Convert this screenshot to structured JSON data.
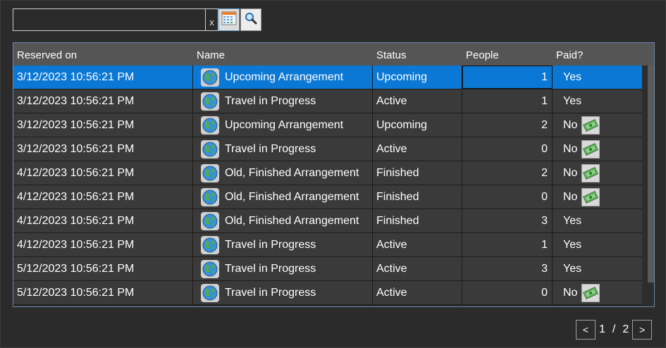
{
  "toolbar": {
    "search_value": "",
    "clear_label": "x",
    "calendar_icon": "calendar-icon",
    "search_icon": "magnifier-icon"
  },
  "grid": {
    "columns": [
      "Reserved on",
      "Name",
      "Status",
      "People",
      "Paid?"
    ],
    "rows": [
      {
        "reserved_on": "3/12/2023 10:56:21 PM",
        "name": "Upcoming Arrangement",
        "status": "Upcoming",
        "people": "1",
        "paid": "Yes",
        "paid_icon": false,
        "selected": true
      },
      {
        "reserved_on": "3/12/2023 10:56:21 PM",
        "name": "Travel in Progress",
        "status": "Active",
        "people": "1",
        "paid": "Yes",
        "paid_icon": false
      },
      {
        "reserved_on": "3/12/2023 10:56:21 PM",
        "name": "Upcoming Arrangement",
        "status": "Upcoming",
        "people": "2",
        "paid": "No",
        "paid_icon": true
      },
      {
        "reserved_on": "3/12/2023 10:56:21 PM",
        "name": "Travel in Progress",
        "status": "Active",
        "people": "0",
        "paid": "No",
        "paid_icon": true
      },
      {
        "reserved_on": "4/12/2023 10:56:21 PM",
        "name": "Old, Finished Arrangement",
        "status": "Finished",
        "people": "2",
        "paid": "No",
        "paid_icon": true
      },
      {
        "reserved_on": "4/12/2023 10:56:21 PM",
        "name": "Old, Finished Arrangement",
        "status": "Finished",
        "people": "0",
        "paid": "No",
        "paid_icon": true
      },
      {
        "reserved_on": "4/12/2023 10:56:21 PM",
        "name": "Old, Finished Arrangement",
        "status": "Finished",
        "people": "3",
        "paid": "Yes",
        "paid_icon": false
      },
      {
        "reserved_on": "4/12/2023 10:56:21 PM",
        "name": "Travel in Progress",
        "status": "Active",
        "people": "1",
        "paid": "Yes",
        "paid_icon": false
      },
      {
        "reserved_on": "5/12/2023 10:56:21 PM",
        "name": "Travel in Progress",
        "status": "Active",
        "people": "3",
        "paid": "Yes",
        "paid_icon": false
      },
      {
        "reserved_on": "5/12/2023 10:56:21 PM",
        "name": "Travel in Progress",
        "status": "Active",
        "people": "0",
        "paid": "No",
        "paid_icon": true
      }
    ]
  },
  "pager": {
    "prev_label": "<",
    "next_label": ">",
    "current_page": "1",
    "separator": "/",
    "total_pages": "2"
  },
  "colors": {
    "background": "#2b2b2b",
    "selection": "#0a78d4",
    "header": "#555555",
    "row": "#3a3a3a"
  }
}
